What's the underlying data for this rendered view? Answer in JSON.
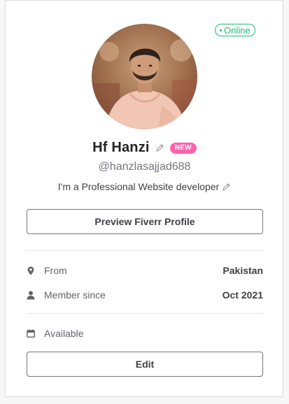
{
  "status": {
    "label": "Online",
    "color": "#1dbf73"
  },
  "profile": {
    "name": "Hf Hanzi",
    "badge": "NEW",
    "badge_color": "#ff62ad",
    "username": "@hanzlasajjad688",
    "tagline": "I'm a Professional Website developer"
  },
  "buttons": {
    "preview": "Preview Fiverr Profile",
    "edit": "Edit"
  },
  "details": [
    {
      "icon": "location-pin-icon",
      "label": "From",
      "value": "Pakistan"
    },
    {
      "icon": "user-icon",
      "label": "Member since",
      "value": "Oct 2021"
    }
  ],
  "availability": {
    "icon": "calendar-icon",
    "label": "Available"
  }
}
